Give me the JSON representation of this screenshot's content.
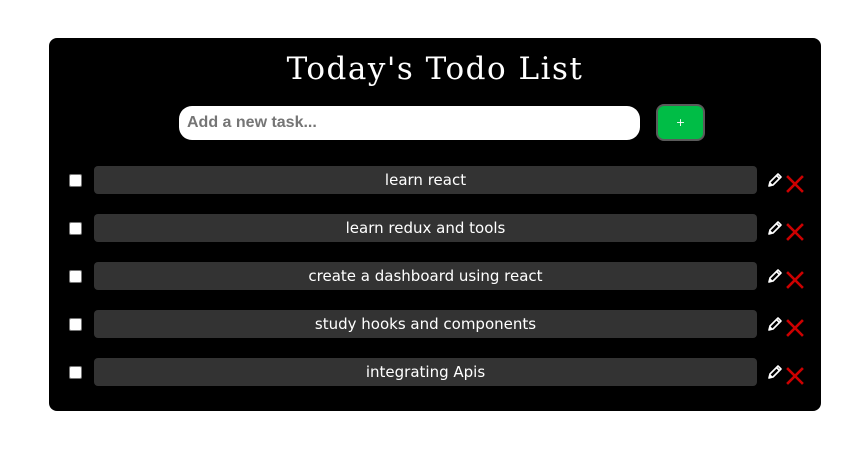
{
  "app": {
    "title": "Today's Todo List",
    "new_task": {
      "placeholder": "Add a new task...",
      "value": ""
    },
    "add_button_label": "+",
    "colors": {
      "card_background": "#000000",
      "task_background": "#333333",
      "add_button": "#00bd46",
      "delete_icon": "#cc0000",
      "edit_icon": "#ffffff"
    },
    "icons": {
      "edit": "pencil-icon",
      "delete": "close-icon"
    },
    "todos": [
      {
        "text": "learn react",
        "done": false
      },
      {
        "text": "learn redux and tools",
        "done": false
      },
      {
        "text": "create a dashboard using react",
        "done": false
      },
      {
        "text": "study hooks and components",
        "done": false
      },
      {
        "text": "integrating Apis",
        "done": false
      }
    ]
  }
}
